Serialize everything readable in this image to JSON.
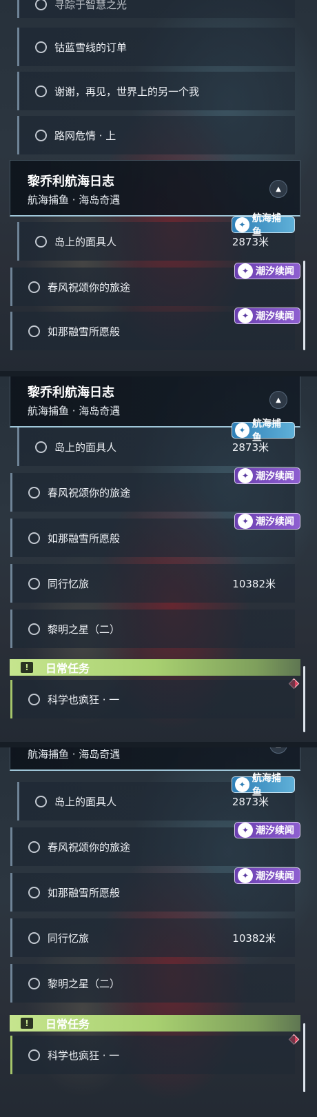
{
  "panel1": {
    "top_partial_item": "寻踪于智慧之光",
    "items": [
      "钴蓝雪线的订单",
      "谢谢，再见，世界上的另一个我",
      "路网危情 · 上"
    ]
  },
  "quest_group": {
    "title": "黎乔利航海日志",
    "subtitle": "航海捕鱼 · 海岛奇遇",
    "collapse_icon": "triangle-up-icon"
  },
  "tags": {
    "fishing": "航海捕鱼",
    "tide": "潮汐续闻"
  },
  "quests": [
    {
      "label": "岛上的面具人",
      "distance": "2873米",
      "tag": "fishing"
    },
    {
      "label": "春风祝颂你的旅途",
      "tag": "tide"
    },
    {
      "label": "如那融雪所愿般",
      "tag": "tide"
    },
    {
      "label": "同行忆旅",
      "distance": "10382米"
    },
    {
      "label": "黎明之星（二）"
    }
  ],
  "daily": {
    "label": "日常任务",
    "icon": "exclamation-icon",
    "items": [
      "科学也疯狂 · 一"
    ]
  },
  "colors": {
    "accent_daily": "#a8d070",
    "tag_fishing": "#4a9ccb",
    "tag_tide": "#7b4fc0",
    "marker": "#d9425e"
  }
}
